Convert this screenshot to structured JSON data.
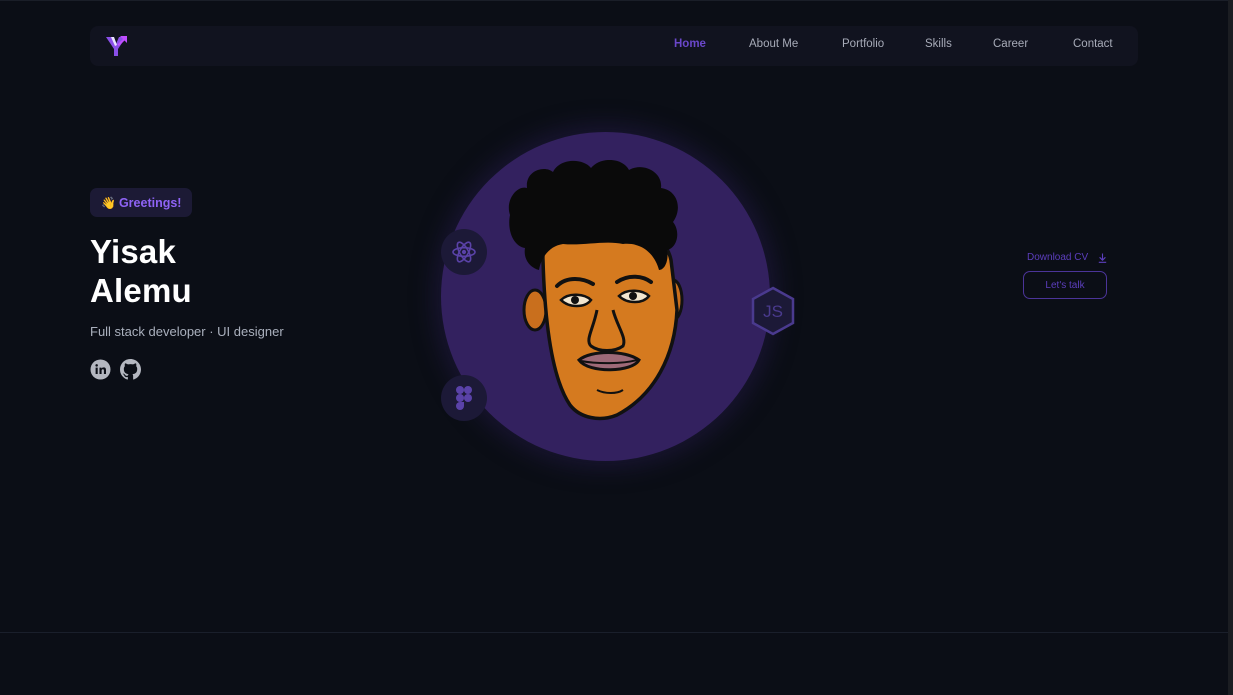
{
  "nav": {
    "logo_icon": "y-logo-icon",
    "items": [
      {
        "label": "Home",
        "active": true
      },
      {
        "label": "About Me",
        "active": false
      },
      {
        "label": "Portfolio",
        "active": false
      },
      {
        "label": "Skills",
        "active": false
      },
      {
        "label": "Career",
        "active": false
      },
      {
        "label": "Contact",
        "active": false
      }
    ]
  },
  "hero": {
    "greeting": {
      "emoji": "👋",
      "text": "Greetings!"
    },
    "name_first": "Yisak",
    "name_last": "Alemu",
    "subtitle": "Full stack developer · UI designer",
    "social": [
      "linkedin-icon",
      "github-icon"
    ],
    "tech_icons": [
      "react-icon",
      "figma-icon",
      "nodejs-icon"
    ],
    "download_label": "Download CV",
    "cta_label": "Let's talk"
  },
  "colors": {
    "background": "#0b0e16",
    "nav_bg": "#11131f",
    "accent": "#6a47c9",
    "circle": "#33215f",
    "greeting_bg": "#1c1a35",
    "greeting_text": "#8e63f5"
  }
}
